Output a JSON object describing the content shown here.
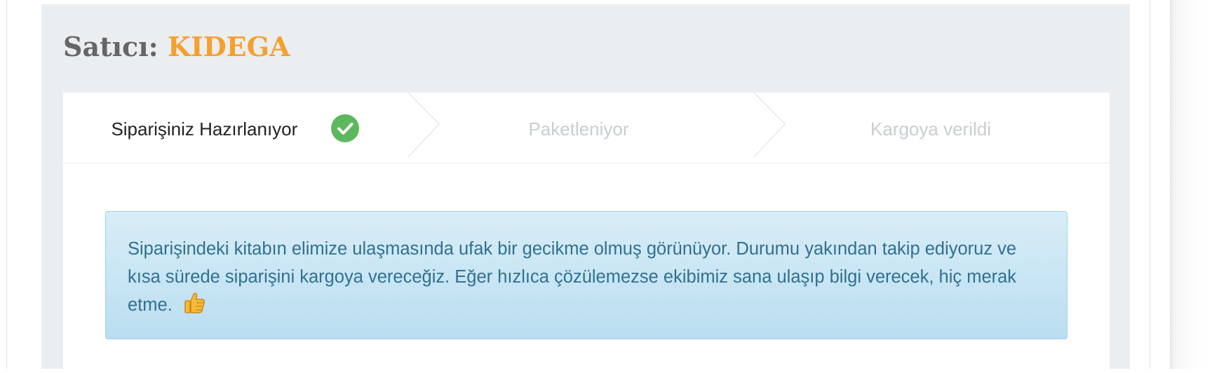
{
  "seller": {
    "prefix": "Satıcı: ",
    "name": "KIDEGA"
  },
  "steps": [
    {
      "label": "Siparişiniz Hazırlanıyor",
      "status": "completed",
      "icon": "check-circle-icon"
    },
    {
      "label": "Paketleniyor",
      "status": "pending"
    },
    {
      "label": "Kargoya verildi",
      "status": "pending"
    }
  ],
  "notice": {
    "text": "Siparişindeki kitabın elimize ulaşmasında ufak bir gecikme olmuş görünüyor. Durumu yakından takip ediyoruz ve kısa sürede siparişini kargoya vereceğiz. Eğer hızlıca çözülemezse ekibimiz sana ulaşıp bilgi verecek, hiç merak etme.",
    "icon": "thumbs-up-icon"
  },
  "colors": {
    "seller_name": "#f5a02e",
    "step_done_check": "#5cb85c",
    "step_pending_text": "#c9ccd1",
    "notice_text": "#31708f",
    "notice_background": "#d9edf7"
  }
}
